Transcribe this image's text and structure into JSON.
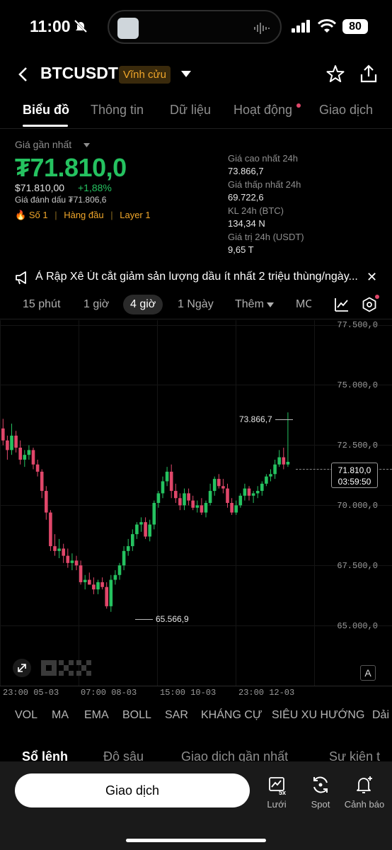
{
  "status_bar": {
    "time": "11:00",
    "battery": "80"
  },
  "header": {
    "symbol": "BTCUSDT",
    "badge": "Vĩnh cửu"
  },
  "tabs": [
    "Biểu đồ",
    "Thông tin",
    "Dữ liệu",
    "Hoạt động",
    "Giao dịch"
  ],
  "price": {
    "last_label": "Giá gần nhất",
    "last_price": "₮71.810,0",
    "usd_price": "$71.810,00",
    "change": "+1,88%",
    "mark_price": "Giá đánh dấu ₮71.806,6",
    "tags": [
      "Số 1",
      "Hàng đầu",
      "Layer 1"
    ]
  },
  "stats": [
    {
      "label": "Giá cao nhất 24h",
      "value": "73.866,7"
    },
    {
      "label": "Giá thấp nhất 24h",
      "value": "69.722,6"
    },
    {
      "label": "KL 24h (BTC)",
      "value": "134,34 N"
    },
    {
      "label": "Giá trị 24h (USDT)",
      "value": "9,65 T"
    }
  ],
  "news": {
    "text": "Ả Rập Xê Út cắt giảm sản lượng dầu ít nhất 2 triệu thùng/ngày..."
  },
  "timeframes": [
    "15 phút",
    "1 giờ",
    "4 giờ",
    "1 Ngày",
    "Thêm",
    "MC"
  ],
  "chart": {
    "y_ticks": [
      "77.500,0",
      "75.000,0",
      "72.500,0",
      "70.000,0",
      "67.500,0",
      "65.000,0"
    ],
    "x_ticks": [
      "23:00 05-03",
      "07:00 08-03",
      "15:00 10-03",
      "23:00 12-03"
    ],
    "high_label": "73.866,7",
    "low_label": "65.566,9",
    "current_price": "71.810,0",
    "countdown": "03:59:50",
    "colors": {
      "up": "#25c260",
      "down": "#e0476a"
    }
  },
  "chart_data": {
    "type": "candlestick",
    "ylim": [
      64000,
      77500
    ],
    "candles": [
      [
        73200,
        73600,
        72500,
        72700
      ],
      [
        72700,
        72900,
        71900,
        72300
      ],
      [
        72300,
        73400,
        72100,
        72900
      ],
      [
        72900,
        73100,
        72200,
        72400
      ],
      [
        72400,
        72700,
        71700,
        71900
      ],
      [
        71900,
        72300,
        71600,
        72100
      ],
      [
        72100,
        72500,
        71900,
        72300
      ],
      [
        72300,
        72400,
        71500,
        71700
      ],
      [
        71700,
        71900,
        71200,
        71400
      ],
      [
        71400,
        71500,
        70300,
        70600
      ],
      [
        70600,
        70800,
        69400,
        69700
      ],
      [
        69700,
        69800,
        68100,
        68300
      ],
      [
        68300,
        68800,
        67900,
        68100
      ],
      [
        68100,
        68600,
        67800,
        68200
      ],
      [
        68200,
        68400,
        67600,
        67900
      ],
      [
        67900,
        68200,
        67400,
        67600
      ],
      [
        67600,
        68000,
        67300,
        67700
      ],
      [
        67700,
        67900,
        67300,
        67500
      ],
      [
        67500,
        67700,
        66700,
        66800
      ],
      [
        66800,
        67100,
        66500,
        66900
      ],
      [
        66900,
        67200,
        66700,
        66700
      ],
      [
        66700,
        67000,
        66300,
        66500
      ],
      [
        66500,
        66900,
        66300,
        66800
      ],
      [
        66800,
        67000,
        66500,
        66600
      ],
      [
        66600,
        66800,
        65700,
        65800
      ],
      [
        65800,
        67100,
        65567,
        66900
      ],
      [
        66900,
        67300,
        66700,
        67100
      ],
      [
        67100,
        67600,
        66900,
        67500
      ],
      [
        67500,
        68300,
        67300,
        68100
      ],
      [
        68100,
        68600,
        67900,
        68300
      ],
      [
        68300,
        69000,
        68100,
        68800
      ],
      [
        68800,
        69300,
        68600,
        69200
      ],
      [
        69200,
        69500,
        68900,
        69300
      ],
      [
        69300,
        69500,
        68600,
        68700
      ],
      [
        68700,
        69400,
        68500,
        69200
      ],
      [
        69200,
        70200,
        69000,
        70100
      ],
      [
        70100,
        70600,
        69900,
        70500
      ],
      [
        70500,
        71200,
        70300,
        71000
      ],
      [
        71000,
        71600,
        70800,
        71400
      ],
      [
        71400,
        71700,
        70300,
        70600
      ],
      [
        70600,
        70900,
        70100,
        70300
      ],
      [
        70300,
        70500,
        69800,
        70000
      ],
      [
        70000,
        70700,
        69800,
        70500
      ],
      [
        70500,
        70700,
        70000,
        70200
      ],
      [
        70200,
        70400,
        69800,
        69900
      ],
      [
        69900,
        70200,
        69700,
        70000
      ],
      [
        70000,
        70300,
        69600,
        69700
      ],
      [
        69700,
        70200,
        69500,
        70100
      ],
      [
        70100,
        70900,
        70000,
        70600
      ],
      [
        70600,
        71200,
        70400,
        71100
      ],
      [
        71100,
        71300,
        70700,
        70800
      ],
      [
        70800,
        71100,
        70500,
        70700
      ],
      [
        70700,
        70900,
        69900,
        70100
      ],
      [
        70100,
        70300,
        69600,
        69700
      ],
      [
        69700,
        70200,
        69600,
        70000
      ],
      [
        70000,
        70500,
        69900,
        70400
      ],
      [
        70400,
        70900,
        70200,
        70700
      ],
      [
        70700,
        70800,
        70200,
        70400
      ],
      [
        70400,
        70600,
        70100,
        70500
      ],
      [
        70500,
        70800,
        70300,
        70600
      ],
      [
        70600,
        71000,
        70400,
        70900
      ],
      [
        70900,
        71300,
        70800,
        71200
      ],
      [
        71200,
        71500,
        71000,
        71300
      ],
      [
        71300,
        71900,
        71100,
        71700
      ],
      [
        71700,
        72300,
        71600,
        72000
      ],
      [
        72000,
        72400,
        71500,
        71700
      ],
      [
        71700,
        73867,
        71600,
        71810
      ]
    ]
  },
  "indicators": [
    "VOL",
    "MA",
    "EMA",
    "BOLL",
    "SAR",
    "KHÁNG CỰ",
    "SIÊU XU HƯỚNG",
    "Dải"
  ],
  "bottom_tabs": [
    "Sổ lệnh",
    "Độ sâu",
    "Giao dịch gần nhất",
    "Sự kiện t"
  ],
  "bottom_bar": {
    "trade": "Giao dịch",
    "grid": "Lưới",
    "spot": "Spot",
    "alert": "Cảnh báo"
  }
}
